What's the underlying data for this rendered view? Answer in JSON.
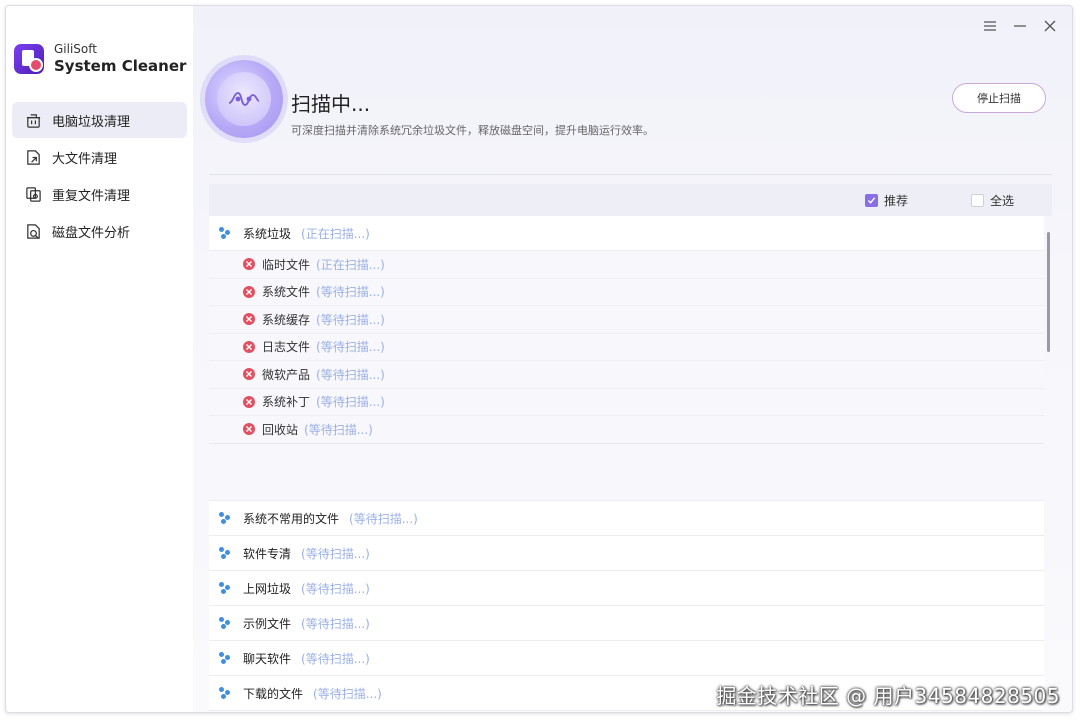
{
  "brand": {
    "company": "GiliSoft",
    "product": "System Cleaner"
  },
  "sidebar": {
    "items": [
      {
        "label": "电脑垃圾清理",
        "icon": "trash-icon",
        "active": true
      },
      {
        "label": "大文件清理",
        "icon": "large-file-icon",
        "active": false
      },
      {
        "label": "重复文件清理",
        "icon": "duplicate-file-icon",
        "active": false
      },
      {
        "label": "磁盘文件分析",
        "icon": "disk-analysis-icon",
        "active": false
      }
    ]
  },
  "header": {
    "title": "扫描中...",
    "description": "可深度扫描并清除系统冗余垃圾文件，释放磁盘空间，提升电脑运行效率。",
    "stop_button": "停止扫描"
  },
  "toolbar": {
    "recommended_label": "推荐",
    "recommended_checked": true,
    "select_all_label": "全选",
    "select_all_checked": false
  },
  "categories": [
    {
      "name": "系统垃圾",
      "status": "(正在扫描...)",
      "expanded": true,
      "items": [
        {
          "name": "临时文件",
          "status": "(正在扫描...)"
        },
        {
          "name": "系统文件",
          "status": "(等待扫描...)"
        },
        {
          "name": "系统缓存",
          "status": "(等待扫描...)"
        },
        {
          "name": "日志文件",
          "status": "(等待扫描...)"
        },
        {
          "name": "微软产品",
          "status": "(等待扫描...)"
        },
        {
          "name": "系统补丁",
          "status": "(等待扫描...)"
        },
        {
          "name": "回收站",
          "status": "(等待扫描...)"
        }
      ]
    },
    {
      "name": "系统不常用的文件",
      "status": "(等待扫描...)"
    },
    {
      "name": "软件专清",
      "status": "(等待扫描...)"
    },
    {
      "name": "上网垃圾",
      "status": "(等待扫描...)"
    },
    {
      "name": "示例文件",
      "status": "(等待扫描...)"
    },
    {
      "name": "聊天软件",
      "status": "(等待扫描...)"
    },
    {
      "name": "下载的文件",
      "status": "(等待扫描...)"
    }
  ],
  "watermark": "掘金技术社区 @ 用户34584828505",
  "colors": {
    "accent": "#8a6ee8",
    "status_text": "#9bb0e3",
    "error": "#e05060"
  }
}
